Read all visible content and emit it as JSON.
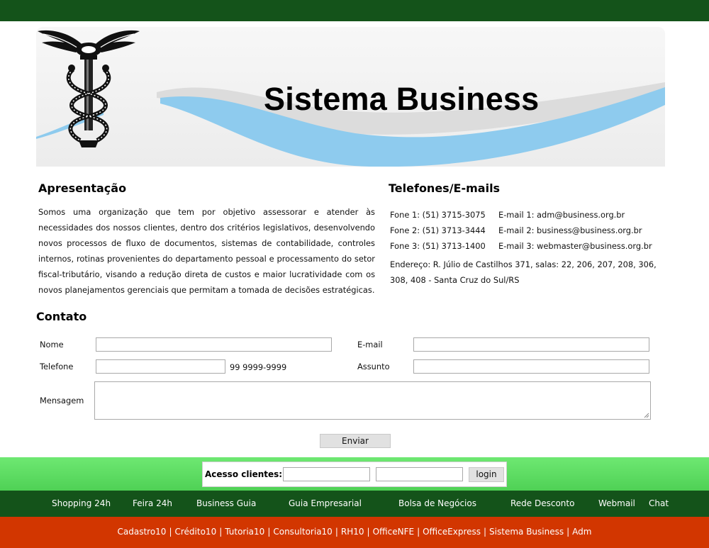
{
  "banner": {
    "title": "Sistema Business",
    "logo_icon": "caduceus-icon"
  },
  "apresentacao": {
    "heading": "Apresentação",
    "text": "Somos uma organização que tem por objetivo assessorar e atender às necessidades dos nossos clientes, dentro dos critérios legislativos, desenvolvendo novos processos de fluxo de documentos, sistemas de contabilidade, controles internos, rotinas provenientes do departamento pessoal e processamento do setor fiscal-tributário, visando a redução direta de custos e maior lucratividade com os novos planejamentos gerenciais que permitam a tomada de decisões estratégicas."
  },
  "contacts": {
    "heading": "Telefones/E-mails",
    "lines": [
      {
        "phone": "Fone 1: (51) 3715-3075",
        "email": "E-mail 1: adm@business.org.br"
      },
      {
        "phone": "Fone 2: (51) 3713-3444",
        "email": "E-mail 2: business@business.org.br"
      },
      {
        "phone": "Fone 3: (51) 3713-1400",
        "email": "E-mail 3: webmaster@business.org.br"
      }
    ],
    "address": "Endereço: R. Júlio de Castilhos 371, salas: 22, 206, 207, 208, 306, 308, 408 - Santa Cruz do Sul/RS"
  },
  "form": {
    "heading": "Contato",
    "name_label": "Nome",
    "name_value": "",
    "email_label": "E-mail",
    "email_value": "",
    "phone_label": "Telefone",
    "phone_value": "",
    "phone_hint": "99 9999-9999",
    "subject_label": "Assunto",
    "subject_value": "",
    "message_label": "Mensagem",
    "message_value": "",
    "submit_label": "Enviar"
  },
  "access": {
    "label": "Acesso clientes:",
    "user_value": "",
    "password_value": "",
    "login_label": "login"
  },
  "nav": {
    "items": [
      "Shopping 24h",
      "Feira 24h",
      "Business Guia",
      "Guia Empresarial",
      "Bolsa de Negócios",
      "Rede Desconto",
      "Webmail",
      "Chat"
    ]
  },
  "footer_links": [
    "Cadastro10",
    "Crédito10",
    "Tutoria10",
    "Consultoria10",
    "RH10",
    "OfficeNFE",
    "OfficeExpress",
    "Sistema Business",
    "Adm"
  ],
  "colors": {
    "dark_green": "#14531a",
    "light_green": "#5ad95f",
    "red": "#d23600",
    "swoosh_blue": "#8ecbee"
  }
}
